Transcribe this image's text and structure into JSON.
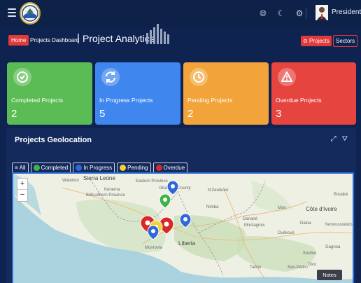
{
  "header": {
    "user_name": "President",
    "icons": [
      "globe-icon",
      "moon-icon",
      "gear-icon"
    ]
  },
  "breadcrumb": {
    "home": "Home",
    "current": "Projects Dashboard",
    "separator": "|",
    "page_title": "Project Analytics"
  },
  "actions": {
    "projects_label": "Projects",
    "sectors_label": "Sectors"
  },
  "cards": [
    {
      "label": "Completed Projects",
      "value": "2",
      "color": "#5bbb54",
      "icon": "check-circle-icon"
    },
    {
      "label": "In Progress Projects",
      "value": "5",
      "color": "#3f86ee",
      "icon": "refresh-icon"
    },
    {
      "label": "Pending Projects",
      "value": "2",
      "color": "#f2a43a",
      "icon": "clock-icon"
    },
    {
      "label": "Overdue Projects",
      "value": "3",
      "color": "#e5453e",
      "icon": "warning-icon"
    }
  ],
  "geolocation": {
    "title": "Projects Geolocation",
    "tabs": [
      {
        "label": "All",
        "color": ""
      },
      {
        "label": "Completed",
        "color": "#3fb24a"
      },
      {
        "label": "In Progress",
        "color": "#2f68d8"
      },
      {
        "label": "Pending",
        "color": "#f0d23a"
      },
      {
        "label": "Overdue",
        "color": "#d82a24"
      }
    ],
    "zoom_in": "+",
    "zoom_out": "−",
    "notes_label": "Notes",
    "map_labels": {
      "sierra_leone": "Sierra Leone",
      "waterloo": "Waterloo",
      "bo": "Bo",
      "kenema": "Kenema",
      "southern_province": "Southern Province",
      "eastern_province": "Eastern Province",
      "gbarpolu": "Gbarpolu County",
      "monrovia": "Monrovia",
      "liberia": "Liberia",
      "nzerekore": "N'Zérékoré",
      "danane": "Danané",
      "man": "Man",
      "montagnes": "Montagnes",
      "duekoue": "Duékoué",
      "daloa": "Daloa",
      "yamoussoukro": "Yamoussoukro",
      "cote_divoire": "Côte d'Ivoire",
      "bouake": "Bouaké",
      "gagnoa": "Gagnoa",
      "soubre": "Soubré",
      "san_pedro": "San-Pédro",
      "divo": "Divo",
      "tabou": "Tabou",
      "nimba": "Nimba"
    }
  }
}
